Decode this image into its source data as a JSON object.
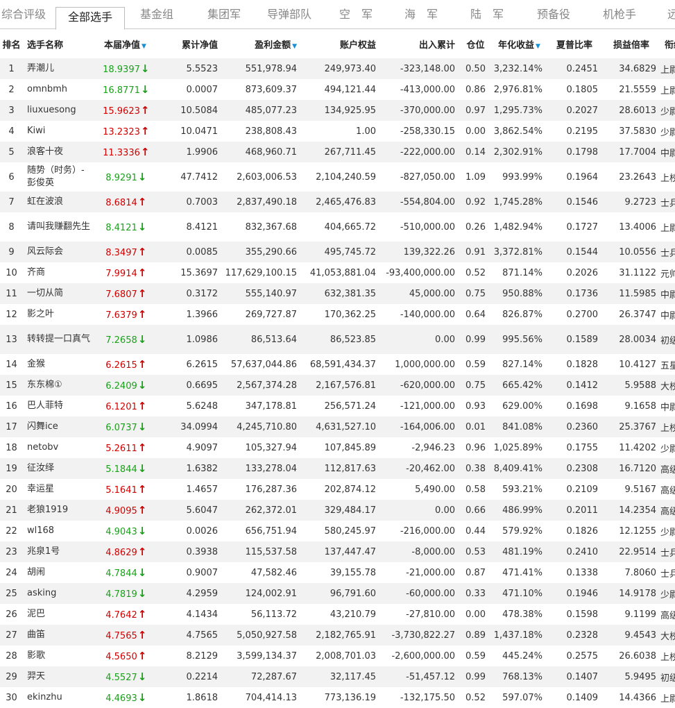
{
  "tabs": [
    {
      "label": "综合评级",
      "active": false
    },
    {
      "label": "全部选手",
      "active": true
    },
    {
      "label": "基金组",
      "active": false
    },
    {
      "label": "集团军",
      "active": false
    },
    {
      "label": "导弹部队",
      "active": false
    },
    {
      "label": "空　军",
      "active": false
    },
    {
      "label": "海　军",
      "active": false
    },
    {
      "label": "陆　军",
      "active": false
    },
    {
      "label": "预备役",
      "active": false
    },
    {
      "label": "机枪手",
      "active": false
    },
    {
      "label": "远",
      "active": false
    }
  ],
  "table": {
    "headers": {
      "rank": "排名",
      "name": "选手名称",
      "weekly_nav": "本届净值",
      "cum_nav": "累计净值",
      "profit": "盈利金额",
      "equity": "账户权益",
      "flow": "出入累计",
      "position": "仓位",
      "annual": "年化收益",
      "sharpe": "夏普比率",
      "ratio": "损益倍率",
      "rank_title": "衔级"
    },
    "sort_marker": "▼",
    "rows": [
      {
        "rank": "1",
        "name": "弄潮儿",
        "weekly_nav": "18.9397",
        "dir": "down",
        "cum_nav": "5.5523",
        "profit": "551,978.94",
        "equity": "249,973.40",
        "flow": "-323,148.00",
        "position": "0.50",
        "annual": "3,232.14%",
        "sharpe": "0.2451",
        "ratio": "34.6829",
        "title": "上尉"
      },
      {
        "rank": "2",
        "name": "omnbmh",
        "weekly_nav": "16.8771",
        "dir": "down",
        "cum_nav": "0.0007",
        "profit": "873,609.37",
        "equity": "494,121.44",
        "flow": "-413,000.00",
        "position": "0.86",
        "annual": "2,976.81%",
        "sharpe": "0.1805",
        "ratio": "21.5559",
        "title": "上尉"
      },
      {
        "rank": "3",
        "name": "liuxuesong",
        "weekly_nav": "15.9623",
        "dir": "up",
        "cum_nav": "10.5084",
        "profit": "485,077.23",
        "equity": "134,925.95",
        "flow": "-370,000.00",
        "position": "0.97",
        "annual": "1,295.73%",
        "sharpe": "0.2027",
        "ratio": "28.6013",
        "title": "少尉"
      },
      {
        "rank": "4",
        "name": "Kiwi",
        "weekly_nav": "13.2323",
        "dir": "up",
        "cum_nav": "10.0471",
        "profit": "238,808.43",
        "equity": "1.00",
        "flow": "-258,330.15",
        "position": "0.00",
        "annual": "3,862.54%",
        "sharpe": "0.2195",
        "ratio": "37.5830",
        "title": "少尉"
      },
      {
        "rank": "5",
        "name": "浪客十夜",
        "weekly_nav": "11.3336",
        "dir": "up",
        "cum_nav": "1.9906",
        "profit": "468,960.71",
        "equity": "267,711.45",
        "flow": "-222,000.00",
        "position": "0.14",
        "annual": "2,302.91%",
        "sharpe": "0.1798",
        "ratio": "17.7004",
        "title": "中尉"
      },
      {
        "rank": "6",
        "name": "随势（时务）-彭俊英",
        "weekly_nav": "8.9291",
        "dir": "down",
        "cum_nav": "47.7412",
        "profit": "2,603,006.53",
        "equity": "2,104,240.59",
        "flow": "-827,050.00",
        "position": "1.09",
        "annual": "993.99%",
        "sharpe": "0.1964",
        "ratio": "23.2643",
        "title": "上校",
        "tall": true
      },
      {
        "rank": "7",
        "name": "虹在波浪",
        "weekly_nav": "8.6814",
        "dir": "up",
        "cum_nav": "0.7003",
        "profit": "2,837,490.18",
        "equity": "2,465,476.83",
        "flow": "-554,804.00",
        "position": "0.92",
        "annual": "1,745.28%",
        "sharpe": "0.1546",
        "ratio": "9.2723",
        "title": "士兵"
      },
      {
        "rank": "8",
        "name": "请叫我赚翻先生",
        "weekly_nav": "8.4121",
        "dir": "down",
        "cum_nav": "8.4121",
        "profit": "832,367.68",
        "equity": "404,665.72",
        "flow": "-510,000.00",
        "position": "0.26",
        "annual": "1,482.94%",
        "sharpe": "0.1727",
        "ratio": "13.4006",
        "title": "上尉",
        "tall": true
      },
      {
        "rank": "9",
        "name": "风云际会",
        "weekly_nav": "8.3497",
        "dir": "up",
        "cum_nav": "0.0085",
        "profit": "355,290.66",
        "equity": "495,745.72",
        "flow": "139,322.26",
        "position": "0.91",
        "annual": "3,372.81%",
        "sharpe": "0.1544",
        "ratio": "10.0556",
        "title": "士兵"
      },
      {
        "rank": "10",
        "name": "齐商",
        "weekly_nav": "7.9914",
        "dir": "up",
        "cum_nav": "15.3697",
        "profit": "117,629,100.15",
        "equity": "41,053,881.04",
        "flow": "-93,400,000.00",
        "position": "0.52",
        "annual": "871.14%",
        "sharpe": "0.2026",
        "ratio": "31.1122",
        "title": "元帅"
      },
      {
        "rank": "11",
        "name": "一切从简",
        "weekly_nav": "7.6807",
        "dir": "up",
        "cum_nav": "0.3172",
        "profit": "555,140.97",
        "equity": "632,381.35",
        "flow": "45,000.00",
        "position": "0.75",
        "annual": "950.88%",
        "sharpe": "0.1736",
        "ratio": "11.5985",
        "title": "中尉"
      },
      {
        "rank": "12",
        "name": "影之叶",
        "weekly_nav": "7.6379",
        "dir": "up",
        "cum_nav": "1.3966",
        "profit": "269,727.87",
        "equity": "170,362.25",
        "flow": "-140,000.00",
        "position": "0.64",
        "annual": "826.87%",
        "sharpe": "0.2700",
        "ratio": "26.3747",
        "title": "中尉"
      },
      {
        "rank": "13",
        "name": "转转提一口真气",
        "weekly_nav": "7.2658",
        "dir": "down",
        "cum_nav": "1.0986",
        "profit": "86,513.64",
        "equity": "86,523.85",
        "flow": "0.00",
        "position": "0.99",
        "annual": "995.56%",
        "sharpe": "0.1589",
        "ratio": "28.0034",
        "title": "初级士官",
        "tall": true
      },
      {
        "rank": "14",
        "name": "金猴",
        "weekly_nav": "6.2615",
        "dir": "up",
        "cum_nav": "6.2615",
        "profit": "57,637,044.86",
        "equity": "68,591,434.37",
        "flow": "1,000,000.00",
        "position": "0.59",
        "annual": "827.14%",
        "sharpe": "0.1828",
        "ratio": "10.4127",
        "title": "五星上将"
      },
      {
        "rank": "15",
        "name": "东东棉①",
        "weekly_nav": "6.2409",
        "dir": "down",
        "cum_nav": "0.6695",
        "profit": "2,567,374.28",
        "equity": "2,167,576.81",
        "flow": "-620,000.00",
        "position": "0.75",
        "annual": "665.42%",
        "sharpe": "0.1412",
        "ratio": "5.9588",
        "title": "大校"
      },
      {
        "rank": "16",
        "name": "巴人菲特",
        "weekly_nav": "6.1201",
        "dir": "up",
        "cum_nav": "5.6248",
        "profit": "347,178.81",
        "equity": "256,571.24",
        "flow": "-121,000.00",
        "position": "0.93",
        "annual": "629.00%",
        "sharpe": "0.1698",
        "ratio": "9.1658",
        "title": "中尉"
      },
      {
        "rank": "17",
        "name": "闪舞ice",
        "weekly_nav": "6.0737",
        "dir": "down",
        "cum_nav": "34.0994",
        "profit": "4,245,710.80",
        "equity": "4,631,527.10",
        "flow": "-164,006.00",
        "position": "0.01",
        "annual": "841.08%",
        "sharpe": "0.2360",
        "ratio": "25.3767",
        "title": "上校"
      },
      {
        "rank": "18",
        "name": "netobv",
        "weekly_nav": "5.2611",
        "dir": "up",
        "cum_nav": "4.9097",
        "profit": "105,327.94",
        "equity": "107,845.89",
        "flow": "-2,946.23",
        "position": "0.96",
        "annual": "1,025.89%",
        "sharpe": "0.1755",
        "ratio": "11.4202",
        "title": "少尉"
      },
      {
        "rank": "19",
        "name": "征汝绎",
        "weekly_nav": "5.1844",
        "dir": "down",
        "cum_nav": "1.6382",
        "profit": "133,278.04",
        "equity": "112,817.63",
        "flow": "-20,462.00",
        "position": "0.38",
        "annual": "8,409.41%",
        "sharpe": "0.2308",
        "ratio": "16.7120",
        "title": "高级士官"
      },
      {
        "rank": "20",
        "name": "幸运星",
        "weekly_nav": "5.1641",
        "dir": "up",
        "cum_nav": "1.4657",
        "profit": "176,287.36",
        "equity": "202,874.12",
        "flow": "5,490.00",
        "position": "0.58",
        "annual": "593.21%",
        "sharpe": "0.2109",
        "ratio": "9.5167",
        "title": "高级士官"
      },
      {
        "rank": "21",
        "name": "老狼1919",
        "weekly_nav": "4.9095",
        "dir": "up",
        "cum_nav": "5.6047",
        "profit": "262,372.01",
        "equity": "329,484.17",
        "flow": "0.00",
        "position": "0.66",
        "annual": "486.99%",
        "sharpe": "0.2011",
        "ratio": "14.2354",
        "title": "高级士官"
      },
      {
        "rank": "22",
        "name": "wl168",
        "weekly_nav": "4.9043",
        "dir": "down",
        "cum_nav": "0.0026",
        "profit": "656,751.94",
        "equity": "580,245.97",
        "flow": "-216,000.00",
        "position": "0.44",
        "annual": "579.92%",
        "sharpe": "0.1826",
        "ratio": "12.1255",
        "title": "少尉"
      },
      {
        "rank": "23",
        "name": "兆泉1号",
        "weekly_nav": "4.8629",
        "dir": "up",
        "cum_nav": "0.3938",
        "profit": "115,537.58",
        "equity": "137,447.47",
        "flow": "-8,000.00",
        "position": "0.53",
        "annual": "481.19%",
        "sharpe": "0.2410",
        "ratio": "22.9514",
        "title": "士兵"
      },
      {
        "rank": "24",
        "name": "胡闹",
        "weekly_nav": "4.7844",
        "dir": "down",
        "cum_nav": "0.9007",
        "profit": "47,582.46",
        "equity": "39,155.78",
        "flow": "-21,000.00",
        "position": "0.87",
        "annual": "471.41%",
        "sharpe": "0.1338",
        "ratio": "7.8060",
        "title": "士兵"
      },
      {
        "rank": "25",
        "name": "asking",
        "weekly_nav": "4.7819",
        "dir": "down",
        "cum_nav": "4.2959",
        "profit": "124,002.91",
        "equity": "96,791.60",
        "flow": "-60,000.00",
        "position": "0.33",
        "annual": "471.10%",
        "sharpe": "0.1946",
        "ratio": "14.9178",
        "title": "少尉"
      },
      {
        "rank": "26",
        "name": "泥巴",
        "weekly_nav": "4.7642",
        "dir": "up",
        "cum_nav": "4.1434",
        "profit": "56,113.72",
        "equity": "43,210.79",
        "flow": "-27,810.00",
        "position": "0.00",
        "annual": "478.38%",
        "sharpe": "0.1598",
        "ratio": "9.1199",
        "title": "高级士官"
      },
      {
        "rank": "27",
        "name": "曲笛",
        "weekly_nav": "4.7565",
        "dir": "up",
        "cum_nav": "4.7565",
        "profit": "5,050,927.58",
        "equity": "2,182,765.91",
        "flow": "-3,730,822.27",
        "position": "0.89",
        "annual": "1,437.18%",
        "sharpe": "0.2328",
        "ratio": "9.4543",
        "title": "大校"
      },
      {
        "rank": "28",
        "name": "影歌",
        "weekly_nav": "4.5650",
        "dir": "up",
        "cum_nav": "8.2129",
        "profit": "3,599,134.37",
        "equity": "2,008,701.03",
        "flow": "-2,600,000.00",
        "position": "0.59",
        "annual": "445.24%",
        "sharpe": "0.2575",
        "ratio": "26.6038",
        "title": "上校"
      },
      {
        "rank": "29",
        "name": "羿天",
        "weekly_nav": "4.5527",
        "dir": "down",
        "cum_nav": "0.2214",
        "profit": "72,287.67",
        "equity": "32,117.45",
        "flow": "-51,457.12",
        "position": "0.99",
        "annual": "768.13%",
        "sharpe": "0.1407",
        "ratio": "5.9495",
        "title": "初级士官"
      },
      {
        "rank": "30",
        "name": "ekinzhu",
        "weekly_nav": "4.4693",
        "dir": "down",
        "cum_nav": "1.8618",
        "profit": "704,414.13",
        "equity": "773,136.19",
        "flow": "-132,175.50",
        "position": "0.52",
        "annual": "597.07%",
        "sharpe": "0.1409",
        "ratio": "14.4366",
        "title": "上尉"
      }
    ]
  }
}
